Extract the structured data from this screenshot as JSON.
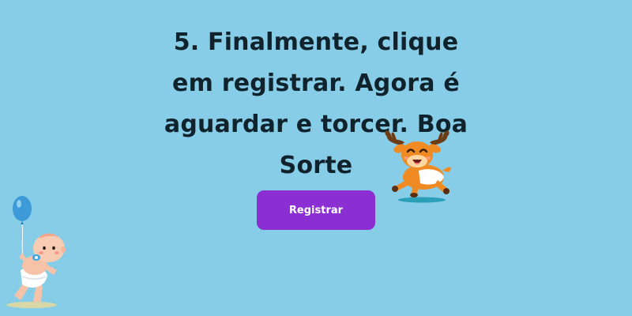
{
  "instruction": {
    "text": "5. Finalmente, clique em registrar. Agora é aguardar e torcer. Boa Sorte"
  },
  "register_button": {
    "label": "Registrar"
  },
  "colors": {
    "background": "#87cde8",
    "text": "#10232c",
    "button": "#8b2fd2",
    "button_text": "#ffffff"
  },
  "illustrations": {
    "moose": "moose-mascot-illustration",
    "baby": "baby-with-balloon-illustration"
  }
}
